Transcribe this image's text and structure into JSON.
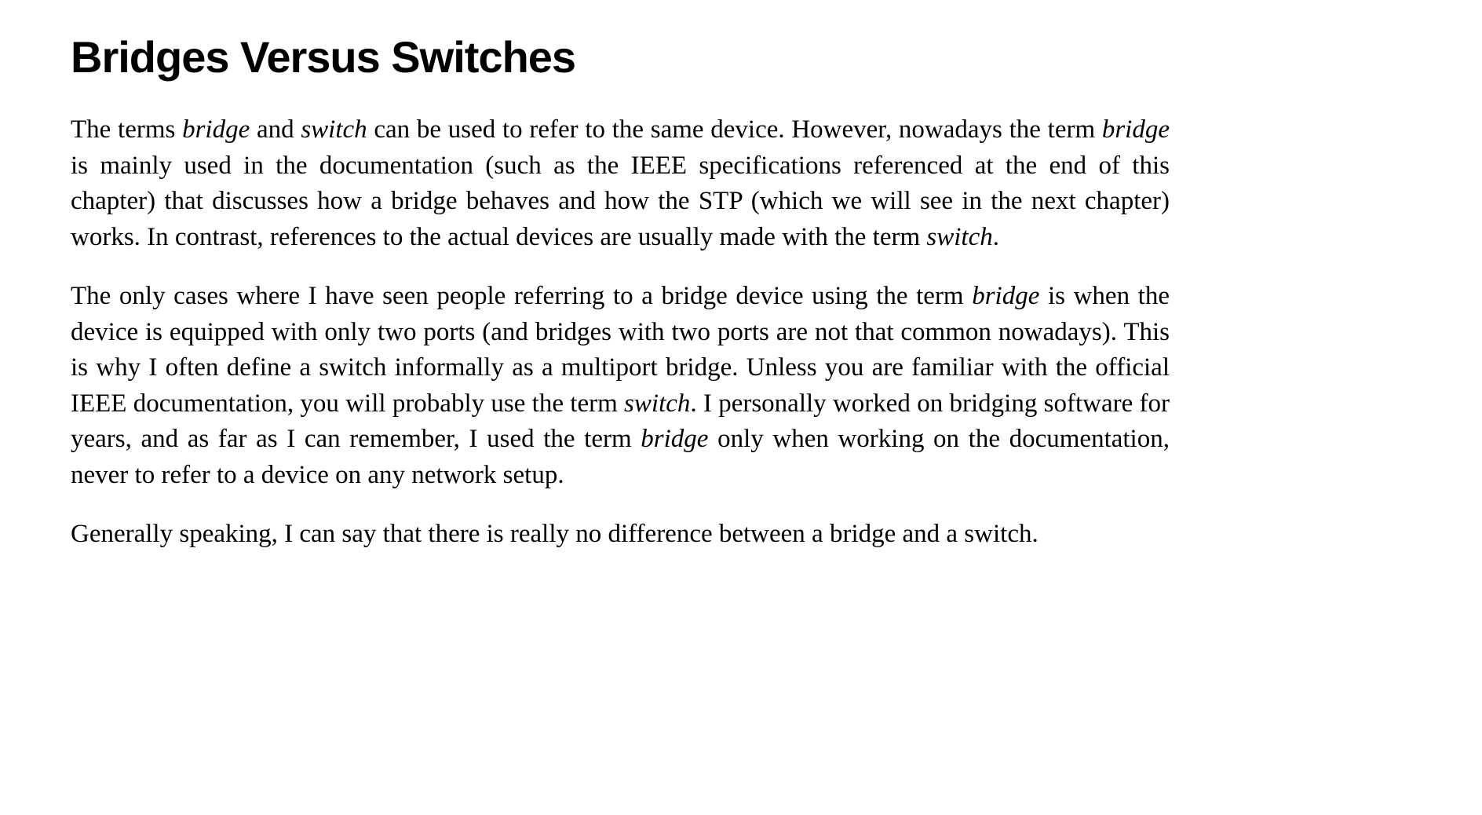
{
  "heading": "Bridges Versus Switches",
  "paragraphs": {
    "p1": {
      "t1": "The terms ",
      "e1": "bridge",
      "t2": " and ",
      "e2": "switch",
      "t3": " can be used to refer to the same device. However, nowadays the term ",
      "e3": "bridge",
      "t4": " is mainly used in the documentation (such as the IEEE specifications referenced at the end of this chapter) that discusses how a bridge behaves and how the STP (which we will see in the next chapter) works. In contrast, references to the actual devices are usually made with the term ",
      "e4": "switch",
      "t5": "."
    },
    "p2": {
      "t1": "The only cases where I have seen people referring to a bridge device using the term ",
      "e1": "bridge",
      "t2": " is when the device is equipped with only two ports (and bridges with two ports are not that common nowadays). This is why I often define a switch informally as a multiport bridge. Unless you are familiar with the official IEEE documentation, you will probably use the term ",
      "e2": "switch",
      "t3": ". I personally worked on bridging software for years, and as far as I can remember, I used the term ",
      "e3": "bridge",
      "t4": " only when working on the documentation, never to refer to a device on any network setup."
    },
    "p3": {
      "t1": "Generally speaking, I can say that there is really no difference between a bridge and a switch."
    }
  }
}
